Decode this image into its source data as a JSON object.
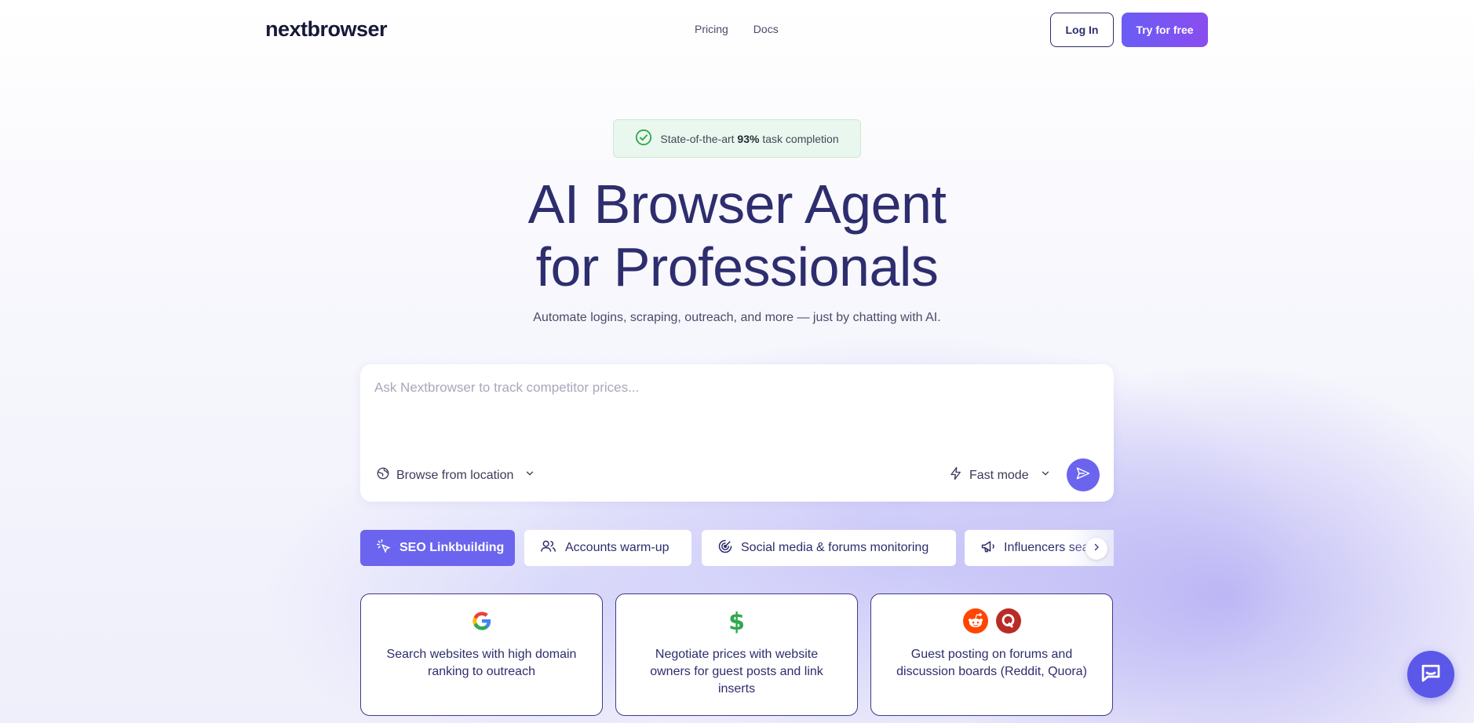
{
  "header": {
    "logo": "nextbrowser",
    "nav": [
      {
        "label": "Pricing"
      },
      {
        "label": "Docs"
      }
    ],
    "login_label": "Log In",
    "try_label": "Try for free"
  },
  "badge": {
    "prefix": "State-of-the-art",
    "highlight": "93%",
    "suffix": "task completion"
  },
  "hero": {
    "title_line1": "AI Browser Agent",
    "title_line2": "for Professionals",
    "subtitle": "Automate logins, scraping, outreach, and more — just by chatting with AI."
  },
  "prompt": {
    "placeholder": "Ask Nextbrowser to track competitor prices...",
    "location_label": "Browse from location",
    "mode_label": "Fast mode"
  },
  "tabs": [
    {
      "label": "SEO Linkbuilding",
      "active": true
    },
    {
      "label": "Accounts warm-up",
      "active": false
    },
    {
      "label": "Social media & forums monitoring",
      "active": false
    },
    {
      "label": "Influencers search",
      "active": false
    }
  ],
  "cards": [
    {
      "text": "Search websites with high domain ranking to outreach",
      "icons": [
        "google-icon"
      ]
    },
    {
      "text": "Negotiate prices with website owners for guest posts and link inserts",
      "icons": [
        "dollar-icon"
      ]
    },
    {
      "text": "Guest posting on forums and discussion boards (Reddit, Quora)",
      "icons": [
        "reddit-icon",
        "quora-icon"
      ]
    }
  ],
  "colors": {
    "accent": "#6a64ef",
    "brand_text": "#2e2d6e",
    "badge_green": "#2fa84f",
    "reddit": "#ff4500",
    "quora": "#b92b27"
  }
}
